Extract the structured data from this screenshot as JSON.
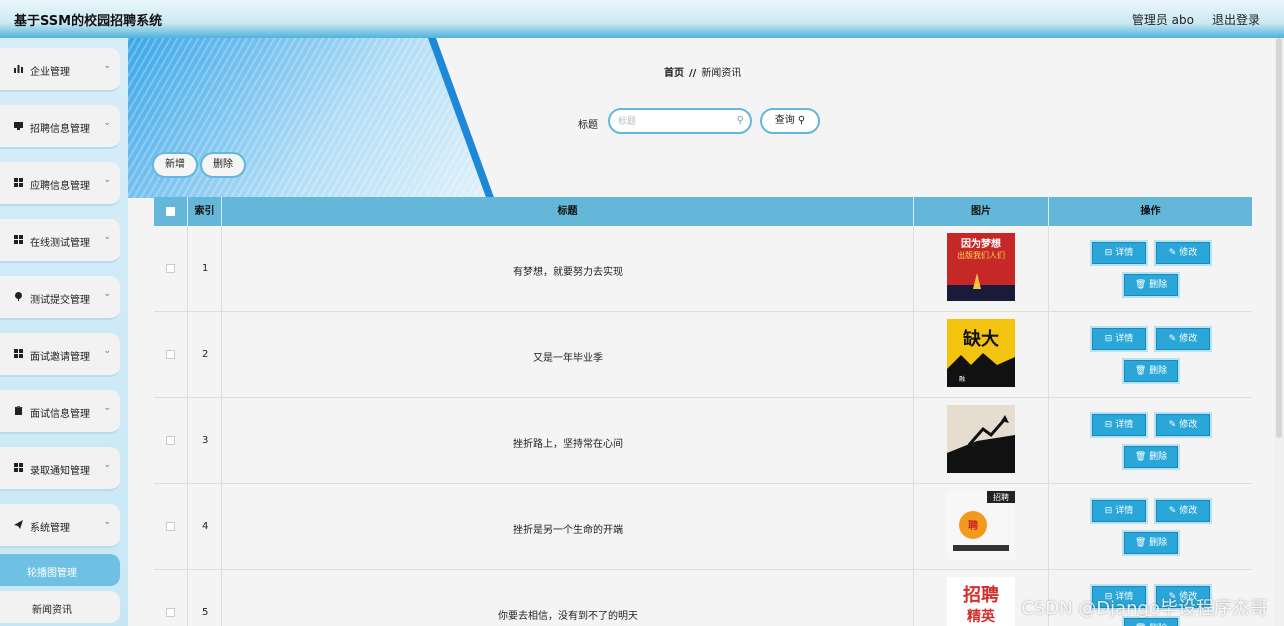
{
  "app": {
    "title": "基于SSM的校园招聘系统",
    "user": "管理员 abo",
    "logout": "退出登录"
  },
  "sidebar": {
    "items": [
      {
        "label": "企业管理",
        "icon": "bar-chart-icon"
      },
      {
        "label": "招聘信息管理",
        "icon": "monitor-icon"
      },
      {
        "label": "应聘信息管理",
        "icon": "grid-icon"
      },
      {
        "label": "在线测试管理",
        "icon": "grid-icon"
      },
      {
        "label": "测试提交管理",
        "icon": "pin-icon"
      },
      {
        "label": "面试邀请管理",
        "icon": "grid-icon"
      },
      {
        "label": "面试信息管理",
        "icon": "clipboard-icon"
      },
      {
        "label": "录取通知管理",
        "icon": "grid-icon"
      },
      {
        "label": "系统管理",
        "icon": "send-icon"
      }
    ],
    "subitems": [
      {
        "label": "轮播图管理",
        "active": true
      },
      {
        "label": "新闻资讯",
        "active": false
      }
    ]
  },
  "breadcrumb": {
    "home": "首页",
    "sep": "//",
    "current": "新闻资讯"
  },
  "search": {
    "label": "标题",
    "placeholder": "标题",
    "button": "查询"
  },
  "toolbar": {
    "add": "新增",
    "delete": "删除"
  },
  "table": {
    "headers": {
      "index": "索引",
      "title": "标题",
      "image": "图片",
      "action": "操作"
    },
    "rows": [
      {
        "index": "1",
        "title": "有梦想，就要努力去实现"
      },
      {
        "index": "2",
        "title": "又是一年毕业季"
      },
      {
        "index": "3",
        "title": "挫折路上，坚持常在心间"
      },
      {
        "index": "4",
        "title": "挫折是另一个生命的开端"
      },
      {
        "index": "5",
        "title": "你要去相信，没有到不了的明天"
      }
    ],
    "row_actions": {
      "detail": "详情",
      "edit": "修改",
      "delete": "删除"
    }
  },
  "thumbs": {
    "t1_top": "因为梦想",
    "t1_mid": "出版我们人们",
    "t2": "缺大",
    "t2_sub": "融",
    "t4_top": "招聘",
    "t4_mid": "聘",
    "t5": "招聘",
    "t5_sub": "精英"
  },
  "watermark": "CSDN @Django毕设程序杰哥"
}
